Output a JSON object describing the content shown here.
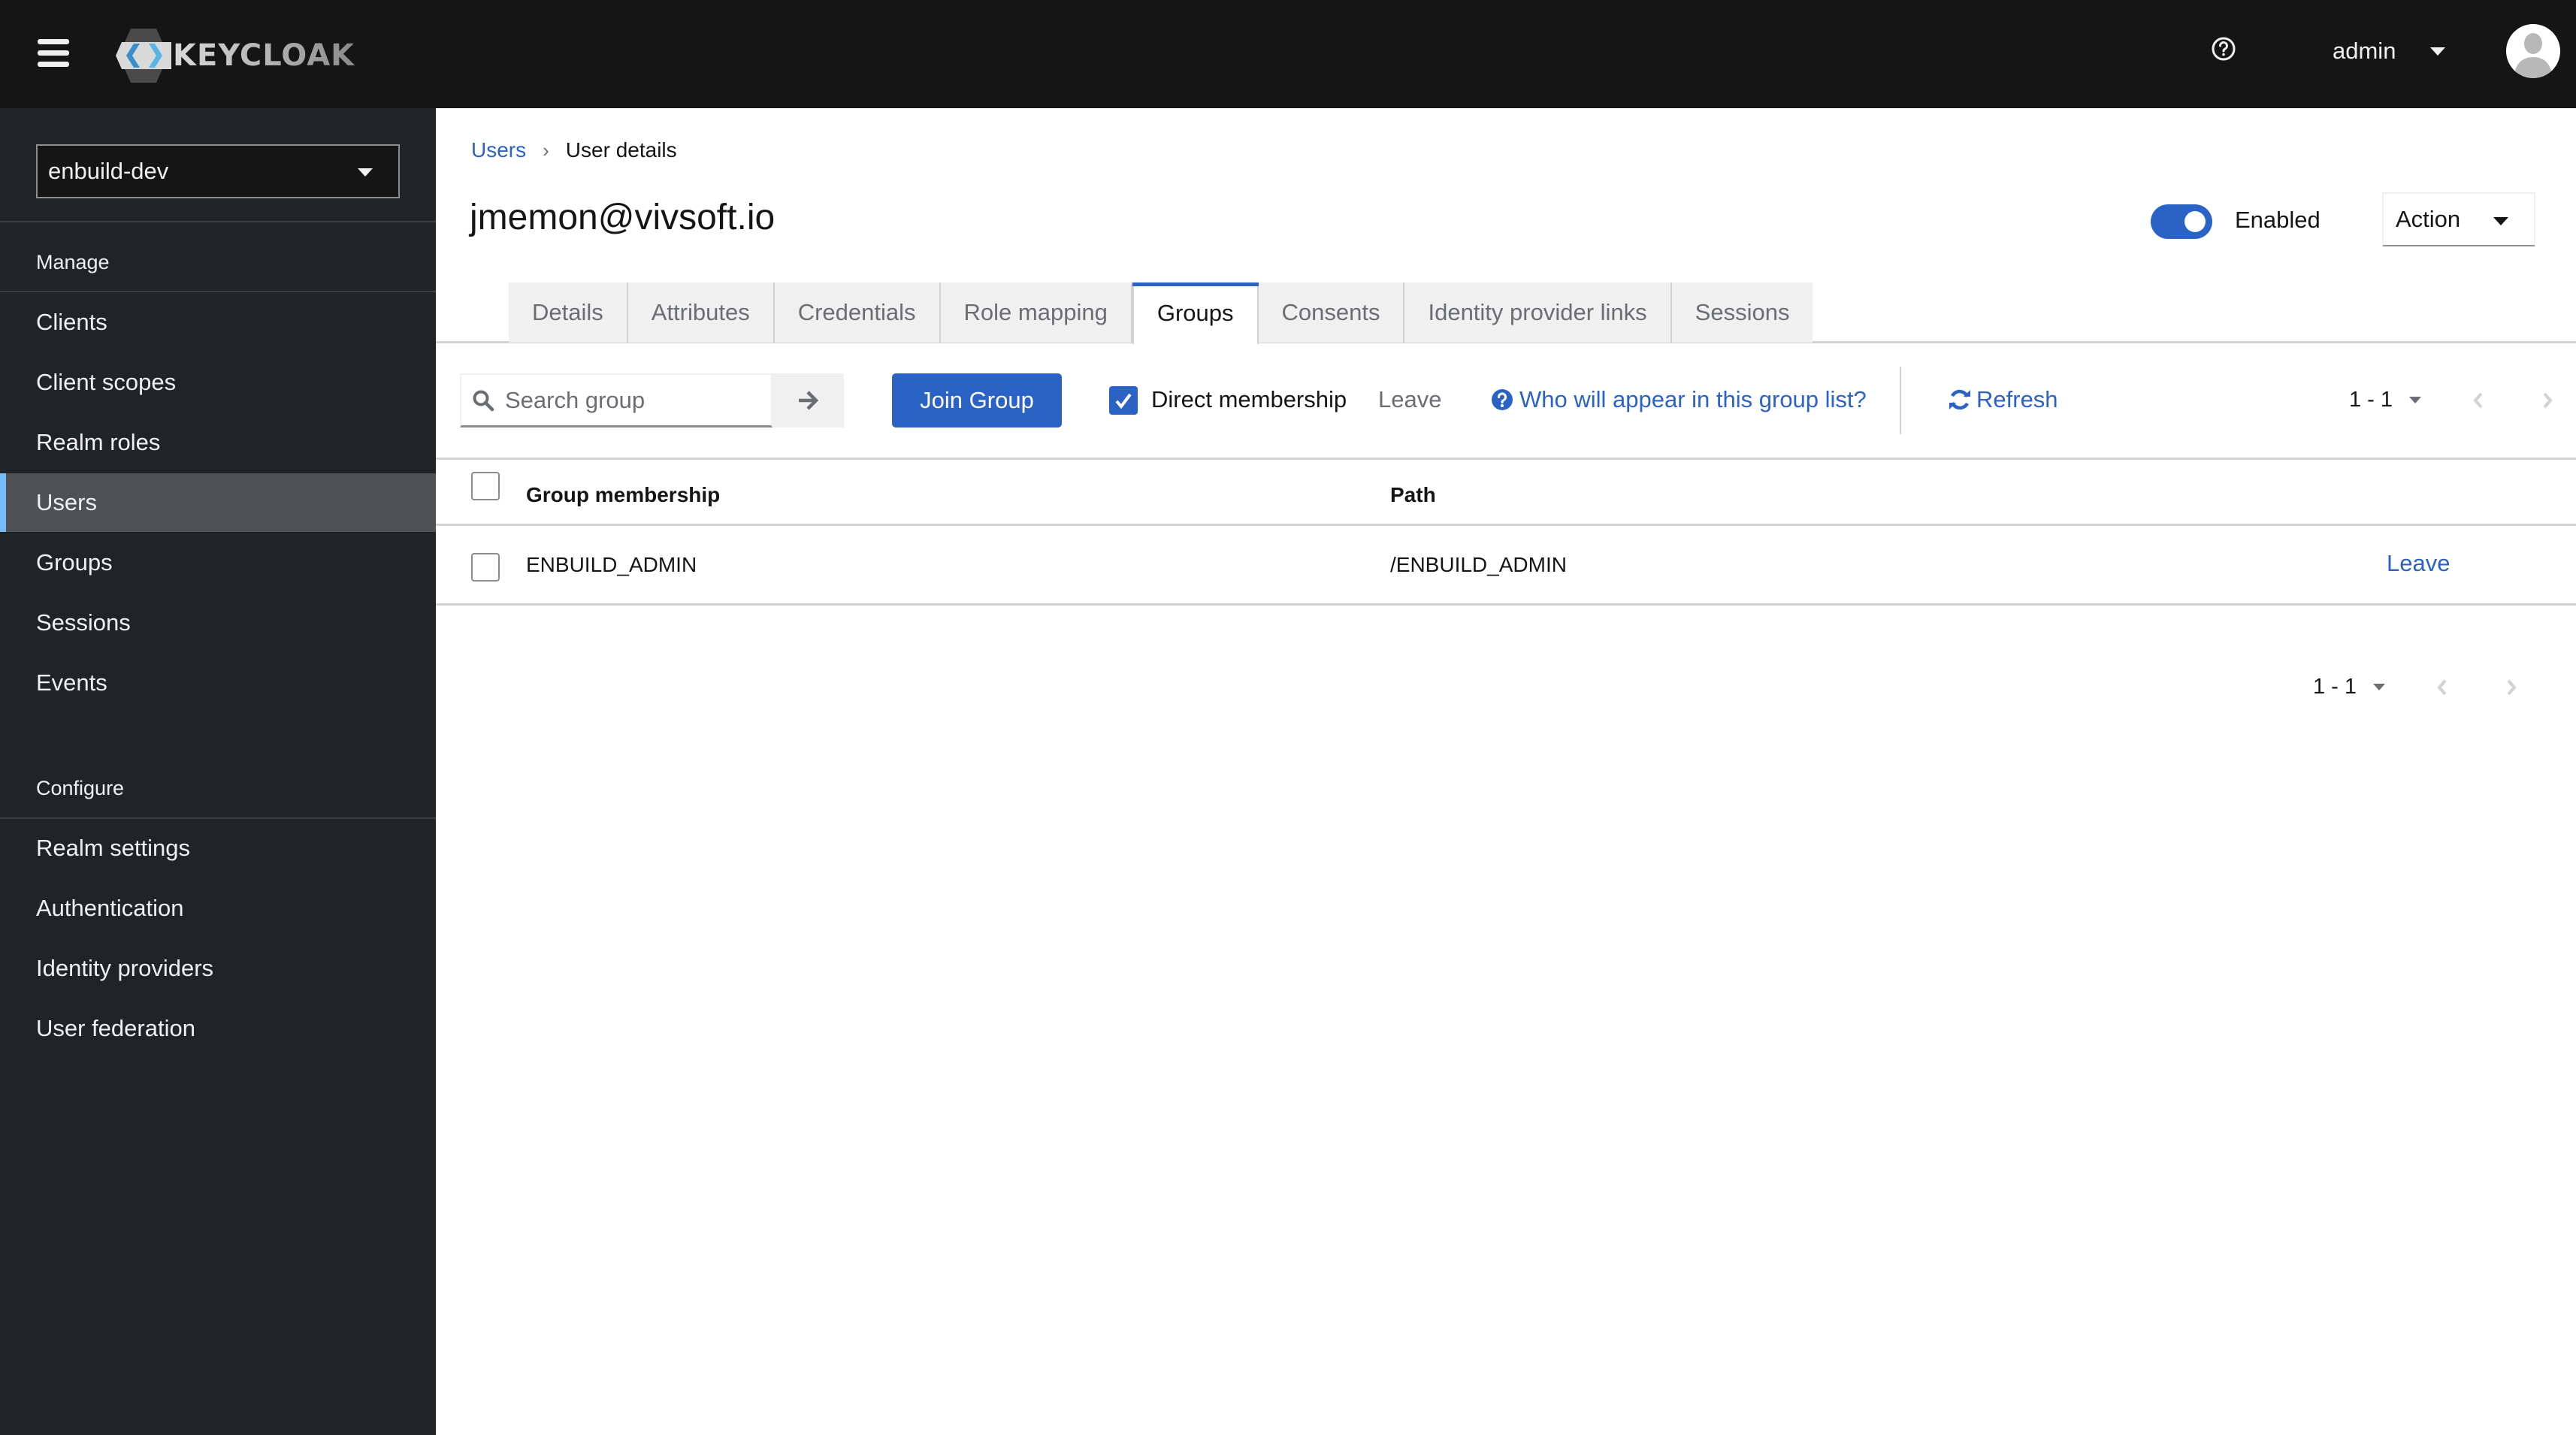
{
  "header": {
    "brand": "KEYCLOAK",
    "user_name": "admin",
    "icons": {
      "menu": "hamburger-icon",
      "help": "help-circle-icon",
      "avatar": "user-avatar-icon"
    }
  },
  "sidebar": {
    "realm": "enbuild-dev",
    "sections": [
      {
        "title": "Manage",
        "items": [
          {
            "label": "Clients",
            "active": false
          },
          {
            "label": "Client scopes",
            "active": false
          },
          {
            "label": "Realm roles",
            "active": false
          },
          {
            "label": "Users",
            "active": true
          },
          {
            "label": "Groups",
            "active": false
          },
          {
            "label": "Sessions",
            "active": false
          },
          {
            "label": "Events",
            "active": false
          }
        ]
      },
      {
        "title": "Configure",
        "items": [
          {
            "label": "Realm settings",
            "active": false
          },
          {
            "label": "Authentication",
            "active": false
          },
          {
            "label": "Identity providers",
            "active": false
          },
          {
            "label": "User federation",
            "active": false
          }
        ]
      }
    ]
  },
  "breadcrumb": [
    {
      "label": "Users",
      "link": true
    },
    {
      "label": "User details",
      "link": false
    }
  ],
  "page": {
    "title": "jmemon@vivsoft.io",
    "enabled_label": "Enabled",
    "enabled": true,
    "action_label": "Action"
  },
  "tabs": [
    {
      "label": "Details",
      "active": false
    },
    {
      "label": "Attributes",
      "active": false
    },
    {
      "label": "Credentials",
      "active": false
    },
    {
      "label": "Role mapping",
      "active": false
    },
    {
      "label": "Groups",
      "active": true
    },
    {
      "label": "Consents",
      "active": false
    },
    {
      "label": "Identity provider links",
      "active": false
    },
    {
      "label": "Sessions",
      "active": false
    }
  ],
  "toolbar": {
    "search_placeholder": "Search group",
    "search_value": "",
    "join_group_label": "Join Group",
    "direct_membership_label": "Direct membership",
    "direct_membership_checked": true,
    "leave_label": "Leave",
    "who_link_label": "Who will appear in this group list?",
    "refresh_label": "Refresh",
    "pagination": "1 - 1"
  },
  "table": {
    "columns": [
      "Group membership",
      "Path"
    ],
    "rows": [
      {
        "group": "ENBUILD_ADMIN",
        "path": "/ENBUILD_ADMIN",
        "action": "Leave"
      }
    ]
  },
  "bottom_pagination": "1 - 1",
  "colors": {
    "accent": "#2b62c6",
    "masthead": "#151515",
    "sidebar": "#212427",
    "sidebar_active": "#4f5255",
    "active_indicator": "#73bcf7"
  }
}
